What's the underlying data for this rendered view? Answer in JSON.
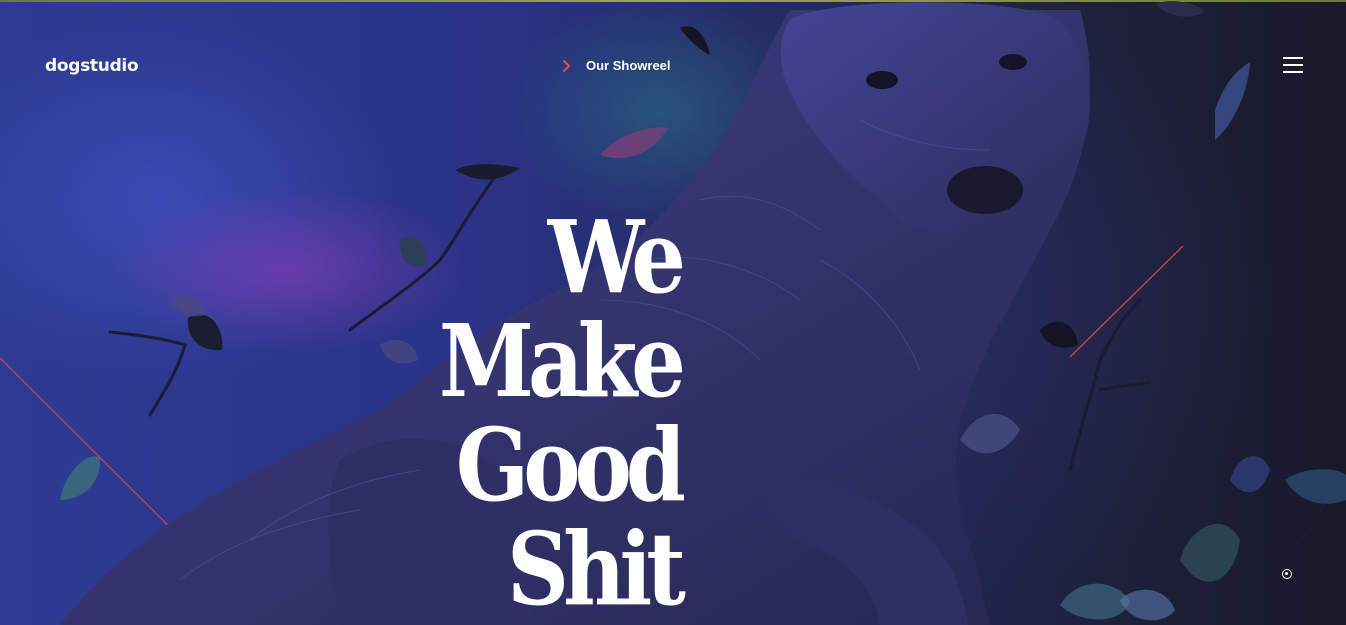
{
  "brand": {
    "logo_text": "dogstudio"
  },
  "nav": {
    "showreel_label": "Our Showreel",
    "menu_icon": "hamburger-menu-icon"
  },
  "hero": {
    "headline_lines": [
      "We",
      "Make",
      "Good",
      "Shit"
    ],
    "illustration": "dog-illustration"
  },
  "colors": {
    "accent": "#e5484d",
    "text": "#ffffff",
    "background_left": "#2d3b93",
    "background_right": "#18192a"
  }
}
